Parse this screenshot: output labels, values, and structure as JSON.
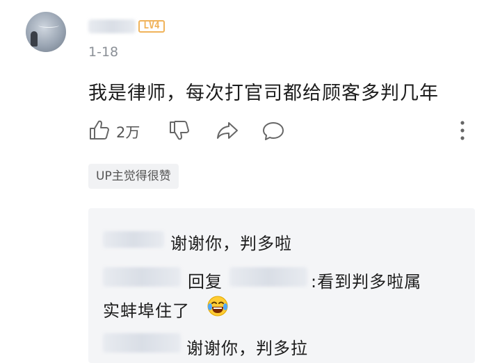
{
  "comment": {
    "level_badge": "LV4",
    "date": "1-18",
    "text": "我是律师，每次打官司都给顾客多判几年",
    "likes": "2万",
    "up_badge": "UP主觉得很赞"
  },
  "replies": [
    {
      "text": "谢谢你，判多啦"
    },
    {
      "reply_word": "回复",
      "text": ":看到判多啦属",
      "text_line2": "实蚌埠住了"
    },
    {
      "text": "谢谢你，判多拉"
    }
  ],
  "icons": {
    "like": "thumbs-up-icon",
    "dislike": "thumbs-down-icon",
    "share": "share-arrow-icon",
    "comment": "speech-bubble-icon",
    "more": "vertical-ellipsis-icon",
    "emoji": "laughing-crying-emoji-icon"
  },
  "colors": {
    "level_badge": "#f0b35a",
    "reply_bg": "#f4f5f7",
    "meta_text": "#8a8f96"
  }
}
